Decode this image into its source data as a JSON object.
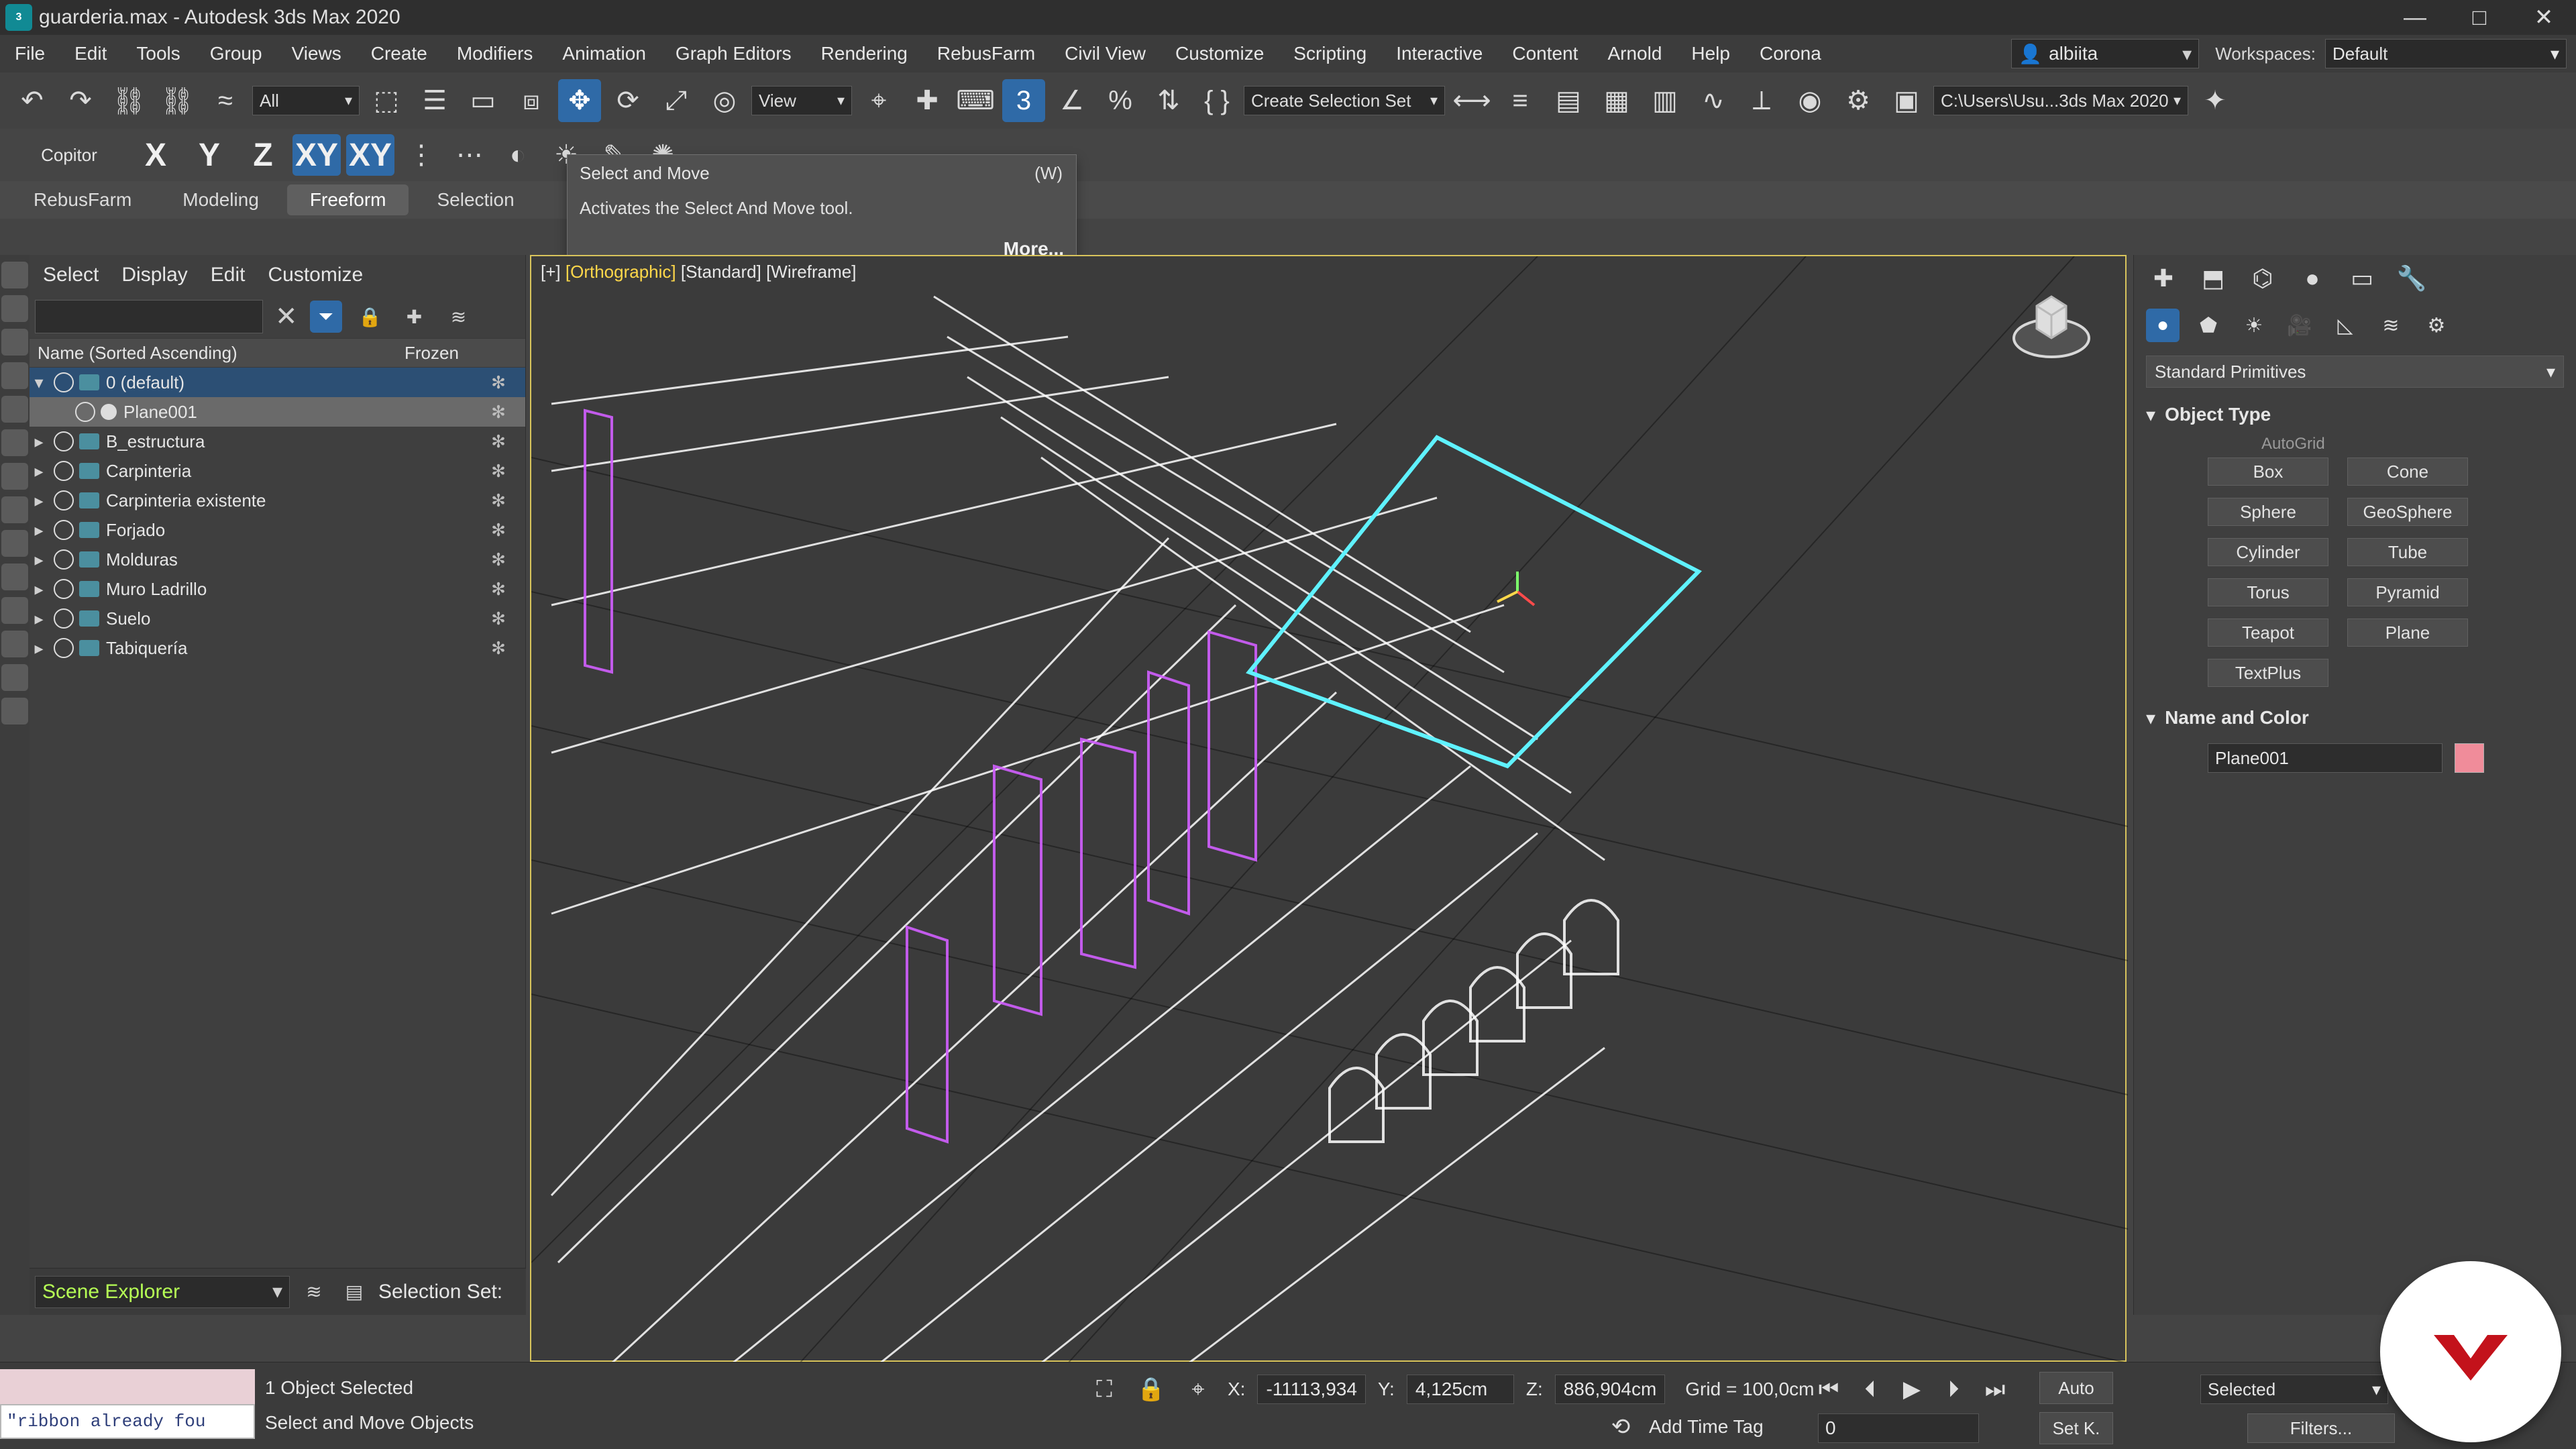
{
  "window": {
    "title": "guarderia.max - Autodesk 3ds Max 2020",
    "controls": [
      "—",
      "□",
      "✕"
    ]
  },
  "menu": {
    "items": [
      "File",
      "Edit",
      "Tools",
      "Group",
      "Views",
      "Create",
      "Modifiers",
      "Animation",
      "Graph Editors",
      "Rendering",
      "RebusFarm",
      "Civil View",
      "Customize",
      "Scripting",
      "Interactive",
      "Content",
      "Arnold",
      "Help",
      "Corona"
    ],
    "user": "albiita",
    "workspaces_label": "Workspaces:",
    "workspace_value": "Default"
  },
  "toolbar": {
    "all_filter": "All",
    "view_select": "View",
    "create_selection_set": "Create Selection Set",
    "path": "C:\\Users\\Usu...3ds Max 2020"
  },
  "toolbar2": {
    "label": "Copitor",
    "axes": [
      "X",
      "Y",
      "Z",
      "XY",
      "XY"
    ]
  },
  "ribbon": {
    "tabs": [
      "RebusFarm",
      "Modeling",
      "Freeform",
      "Selection"
    ],
    "active": "Freeform"
  },
  "tooltip": {
    "title": "Select and Move",
    "shortcut": "(W)",
    "description": "Activates the Select And Move tool.",
    "more": "More..."
  },
  "scene_explorer": {
    "menu": [
      "Select",
      "Display",
      "Edit",
      "Customize"
    ],
    "columns": {
      "name": "Name (Sorted Ascending)",
      "frozen": "Frozen"
    },
    "rows": [
      {
        "name": "0 (default)",
        "type": "layer",
        "selected": true,
        "expanded": true
      },
      {
        "name": "Plane001",
        "type": "object",
        "selected2": true
      },
      {
        "name": "B_estructura",
        "type": "layer"
      },
      {
        "name": "Carpinteria",
        "type": "layer"
      },
      {
        "name": "Carpinteria existente",
        "type": "layer"
      },
      {
        "name": "Forjado",
        "type": "layer"
      },
      {
        "name": "Molduras",
        "type": "layer"
      },
      {
        "name": "Muro Ladrillo",
        "type": "layer"
      },
      {
        "name": "Suelo",
        "type": "layer"
      },
      {
        "name": "Tabiquería",
        "type": "layer"
      }
    ],
    "bottom_dropdown": "Scene Explorer",
    "selection_set_label": "Selection Set:"
  },
  "viewport": {
    "label": [
      "[+]",
      "[Orthographic]",
      "[Standard]",
      "[Wireframe]"
    ]
  },
  "command_panel": {
    "dropdown": "Standard Primitives",
    "object_type_title": "Object Type",
    "autogrid": "AutoGrid",
    "buttons": [
      "Box",
      "Cone",
      "Sphere",
      "GeoSphere",
      "Cylinder",
      "Tube",
      "Torus",
      "Pyramid",
      "Teapot",
      "Plane",
      "TextPlus"
    ],
    "name_color_title": "Name and Color",
    "object_name": "Plane001",
    "object_color": "#f08c9a"
  },
  "status": {
    "mini_listener_text": "\"ribbon already fou",
    "line1": "1 Object Selected",
    "line2": "Select and Move Objects",
    "x_label": "X:",
    "x_value": "-11113,934",
    "y_label": "Y:",
    "y_value": "4,125cm",
    "z_label": "Z:",
    "z_value": "886,904cm",
    "grid": "Grid = 100,0cm",
    "add_time_tag": "Add Time Tag",
    "frame": "0",
    "auto": "Auto",
    "setk": "Set K.",
    "selected_dd": "Selected",
    "filters": "Filters..."
  }
}
